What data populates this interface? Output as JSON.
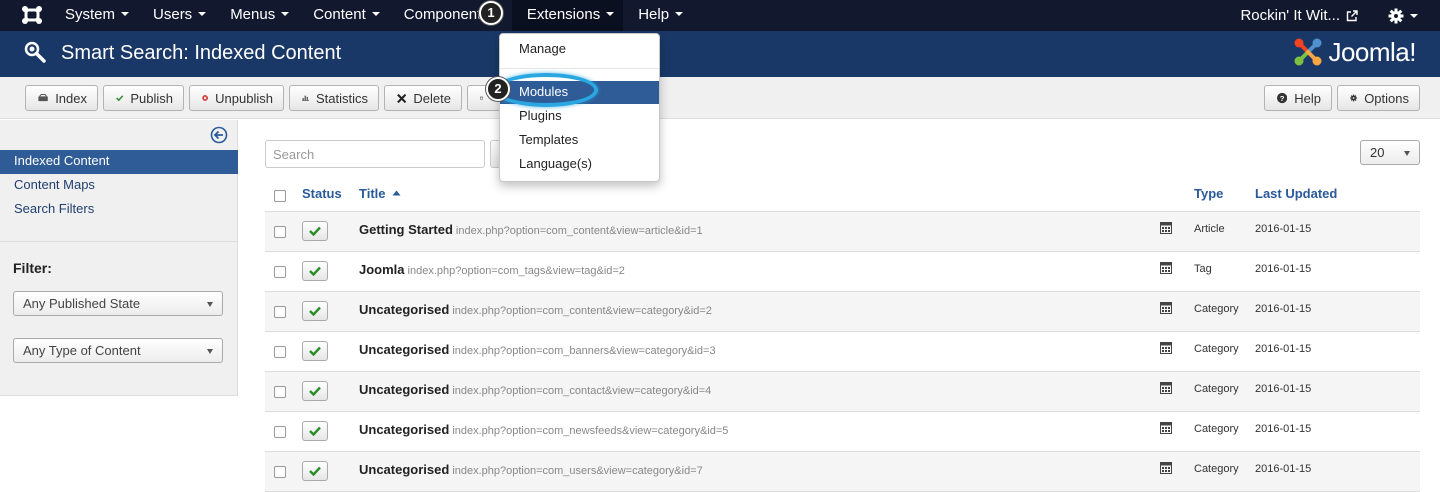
{
  "topnav": {
    "menu": [
      {
        "label": "System"
      },
      {
        "label": "Users"
      },
      {
        "label": "Menus"
      },
      {
        "label": "Content"
      },
      {
        "label": "Components"
      },
      {
        "label": "Extensions"
      },
      {
        "label": "Help"
      }
    ],
    "site_name": "Rockin' It Wit..."
  },
  "header": {
    "title": "Smart Search: Indexed Content",
    "logo_text": "Joomla!"
  },
  "toolbar": {
    "index": "Index",
    "publish": "Publish",
    "unpublish": "Unpublish",
    "statistics": "Statistics",
    "delete": "Delete",
    "help": "Help",
    "options": "Options"
  },
  "sidebar": {
    "items": [
      "Indexed Content",
      "Content Maps",
      "Search Filters"
    ],
    "filter_label": "Filter:",
    "published_state": "Any Published State",
    "content_type": "Any Type of Content"
  },
  "main": {
    "search_placeholder": "Search",
    "limit": "20",
    "columns": {
      "status": "Status",
      "title": "Title",
      "type": "Type",
      "updated": "Last Updated"
    },
    "rows": [
      {
        "title": "Getting Started",
        "url": "index.php?option=com_content&view=article&id=1",
        "type": "Article",
        "date": "2016-01-15"
      },
      {
        "title": "Joomla",
        "url": "index.php?option=com_tags&view=tag&id=2",
        "type": "Tag",
        "date": "2016-01-15"
      },
      {
        "title": "Uncategorised",
        "url": "index.php?option=com_content&view=category&id=2",
        "type": "Category",
        "date": "2016-01-15"
      },
      {
        "title": "Uncategorised",
        "url": "index.php?option=com_banners&view=category&id=3",
        "type": "Category",
        "date": "2016-01-15"
      },
      {
        "title": "Uncategorised",
        "url": "index.php?option=com_contact&view=category&id=4",
        "type": "Category",
        "date": "2016-01-15"
      },
      {
        "title": "Uncategorised",
        "url": "index.php?option=com_newsfeeds&view=category&id=5",
        "type": "Category",
        "date": "2016-01-15"
      },
      {
        "title": "Uncategorised",
        "url": "index.php?option=com_users&view=category&id=7",
        "type": "Category",
        "date": "2016-01-15"
      }
    ]
  },
  "extensions_menu": {
    "items": [
      "Manage",
      "Modules",
      "Plugins",
      "Templates",
      "Language(s)"
    ],
    "active": "Modules"
  },
  "annotations": {
    "step1": "1",
    "step2": "2"
  },
  "colors": {
    "nav_bg": "#12192f",
    "header_bg": "#1a3867",
    "active_item": "#2f5b96",
    "highlight_ring": "#2aa7e0",
    "published_check": "#2c8a2c"
  }
}
